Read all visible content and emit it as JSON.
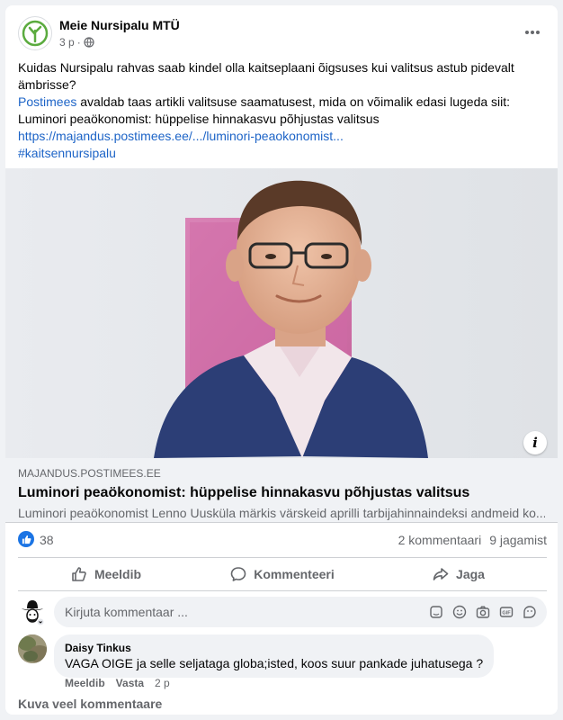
{
  "post": {
    "page_name": "Meie Nursipalu MTÜ",
    "time": "3 p",
    "dot": "·",
    "audience_icon": "globe-icon",
    "text": {
      "line1": "Kuidas Nursipalu rahvas saab kindel olla kaitseplaani õigsuses kui valitsus astub pidevalt",
      "line2": "ämbrisse?",
      "mention": "Postimees",
      "line3_rest": " avaldab taas artikli valitsuse saamatusest, mida on võimalik edasi lugeda siit:",
      "line4": "Luminori peaökonomist: hüppelise hinnakasvu põhjustas valitsus",
      "url": "https://majandus.postimees.ee/.../luminori-peaokonomist...",
      "hashtag": "#kaitsennursipalu"
    }
  },
  "link_preview": {
    "domain": "MAJANDUS.POSTIMEES.EE",
    "title": "Luminori peaökonomist: hüppelise hinnakasvu põhjustas valitsus",
    "description": "Luminori peaökonomist Lenno Uusküla märkis värskeid aprilli tarbijahinnaindeksi andmeid ko..."
  },
  "stats": {
    "reactions": "38",
    "comments": "2 kommentaari",
    "shares": "9 jagamist"
  },
  "actions": {
    "like": "Meeldib",
    "comment": "Kommenteeri",
    "share": "Jaga"
  },
  "composer": {
    "placeholder": "Kirjuta kommentaar ...",
    "icons": [
      "sticker-icon",
      "emoji-icon",
      "camera-icon",
      "gif-icon",
      "avatar-sticker-icon"
    ]
  },
  "comments": [
    {
      "author": "Daisy Tinkus",
      "text": "VAGA OIGE ja selle seljataga globa;isted, koos suur pankade juhatusega ?",
      "like_label": "Meeldib",
      "reply_label": "Vasta",
      "time": "2 p"
    }
  ],
  "more_comments": "Kuva veel kommentaare",
  "colors": {
    "link": "#1d64c7",
    "like_blue": "#1b74e4",
    "secondary_text": "#65676b",
    "logo_green": "#5bab3f"
  }
}
